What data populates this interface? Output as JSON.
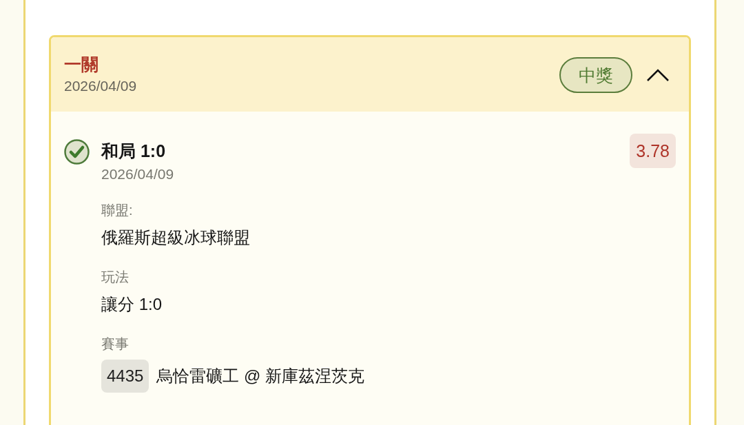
{
  "card": {
    "title": "一關",
    "date": "2026/04/09",
    "status_badge": "中獎",
    "expanded": true,
    "selection": {
      "won": true,
      "title": "和局 1:0",
      "date": "2026/04/09",
      "odds": "3.78",
      "fields": [
        {
          "kind": "text",
          "label": "聯盟:",
          "value": "俄羅斯超級冰球聯盟"
        },
        {
          "kind": "text",
          "label": "玩法",
          "value": "讓分 1:0"
        },
        {
          "kind": "match",
          "label": "賽事",
          "match_id": "4435",
          "value": "烏恰雷礦工 @ 新庫茲涅茨克"
        }
      ]
    }
  }
}
